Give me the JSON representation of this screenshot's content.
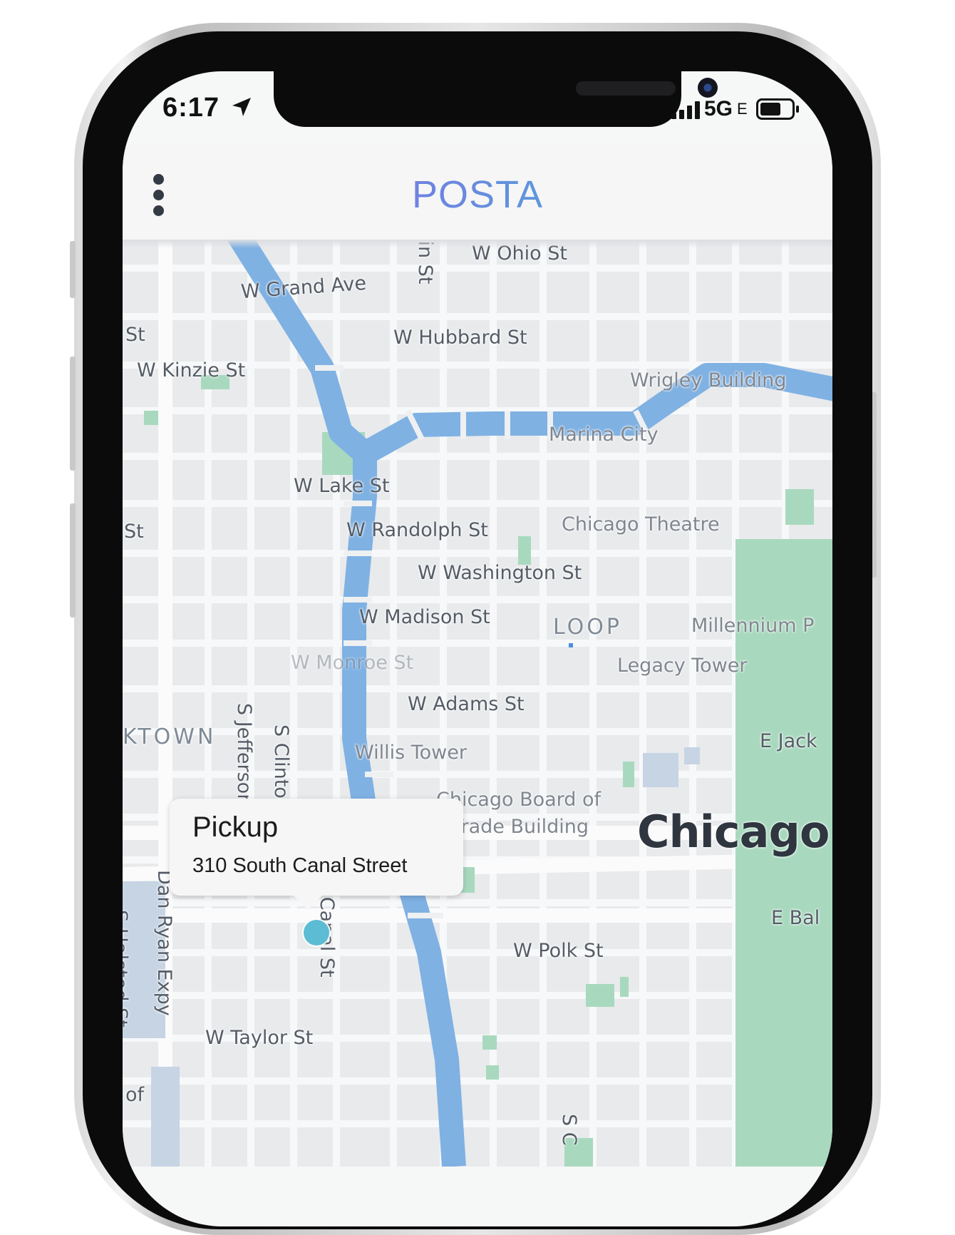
{
  "status_bar": {
    "time": "6:17",
    "network": "5G",
    "network_suffix": "E"
  },
  "header": {
    "brand": "POSTA"
  },
  "map": {
    "streets": {
      "ohio": "W Ohio St",
      "grand": "W Grand Ave",
      "hubbard": "W Hubbard St",
      "kinzie": "W Kinzie St",
      "lake": "W Lake St",
      "randolph": "W Randolph St",
      "washington": "W Washington St",
      "madison": "W Madison St",
      "monroe": "W Monroe St",
      "adams": "W Adams St",
      "polk": "W Polk St",
      "taylor": "W Taylor St",
      "jefferson": "S Jefferson St",
      "clinton": "S Clinton St",
      "canal": "S Canal St",
      "dan_ryan": "Dan Ryan Expy",
      "halsted": "S Halsted St",
      "franklin_partial": "lin St",
      "st_left_top": "St",
      "st_left_mid": "St",
      "jackson_partial": "E Jack",
      "balbo_partial": "E Bal",
      "of_partial": "of",
      "sc_partial": "S C"
    },
    "pois": {
      "wrigley": "Wrigley Building",
      "marina": "Marina City",
      "chicago_theatre": "Chicago Theatre",
      "millennium": "Millennium P",
      "legacy": "Legacy Tower",
      "willis": "Willis Tower",
      "cbot_line1": "Chicago Board of",
      "cbot_line2": "Trade Building"
    },
    "districts": {
      "loop": "LOOP",
      "greektown_partial": "KTOWN"
    },
    "city": "Chicago"
  },
  "pickup": {
    "title": "Pickup",
    "address": "310 South Canal Street"
  },
  "colors": {
    "river": "#7fb1e3",
    "park": "#a8d9be",
    "pin": "#5bbcd3",
    "map_bg": "#e8eaec"
  }
}
